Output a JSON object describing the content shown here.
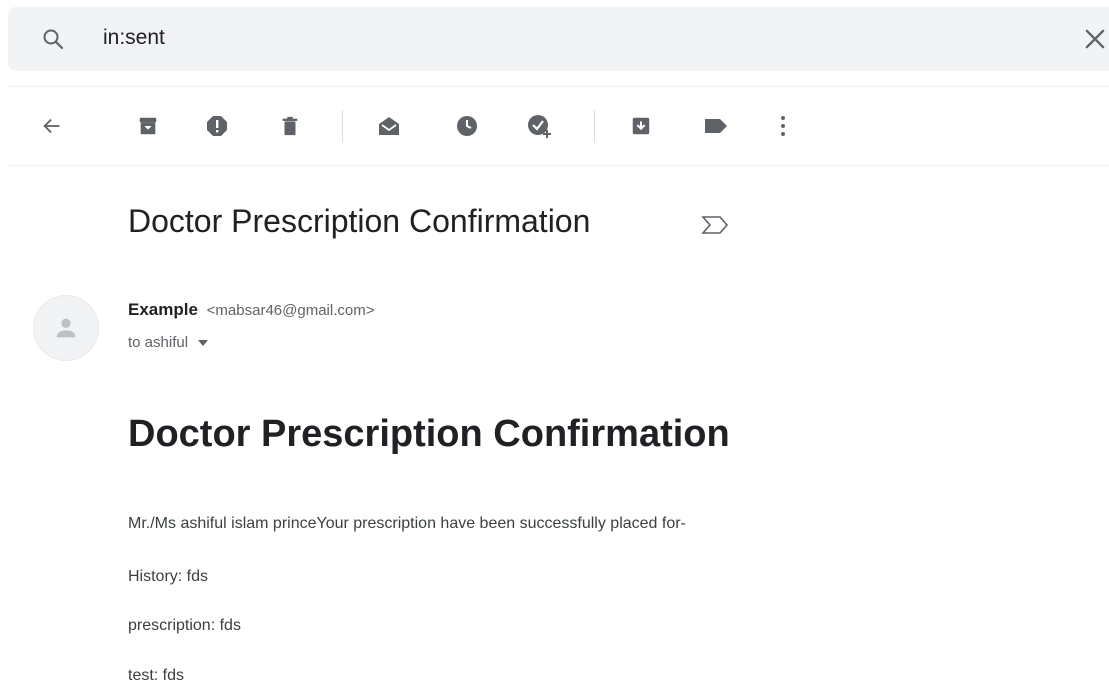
{
  "search": {
    "query": "in:sent"
  },
  "toolbar": {
    "icons": [
      "back-arrow-icon",
      "archive-icon",
      "report-spam-icon",
      "delete-icon",
      "mark-unread-icon",
      "snooze-icon",
      "add-to-tasks-icon",
      "move-to-icon",
      "label-icon",
      "more-options-icon"
    ]
  },
  "email": {
    "subject": "Doctor Prescription Confirmation",
    "sender_name": "Example",
    "sender_email": "<mabsar46@gmail.com>",
    "recipient": "to ashiful",
    "body_heading": "Doctor Prescription Confirmation",
    "body_lines": [
      "Mr./Ms ashiful islam princeYour prescription have been successfully placed for-",
      "History: fds",
      "prescription: fds",
      "test: fds"
    ]
  },
  "colors": {
    "search_bg": "#f1f3f4",
    "icon_gray": "#5f6368",
    "text_primary": "#202124"
  }
}
